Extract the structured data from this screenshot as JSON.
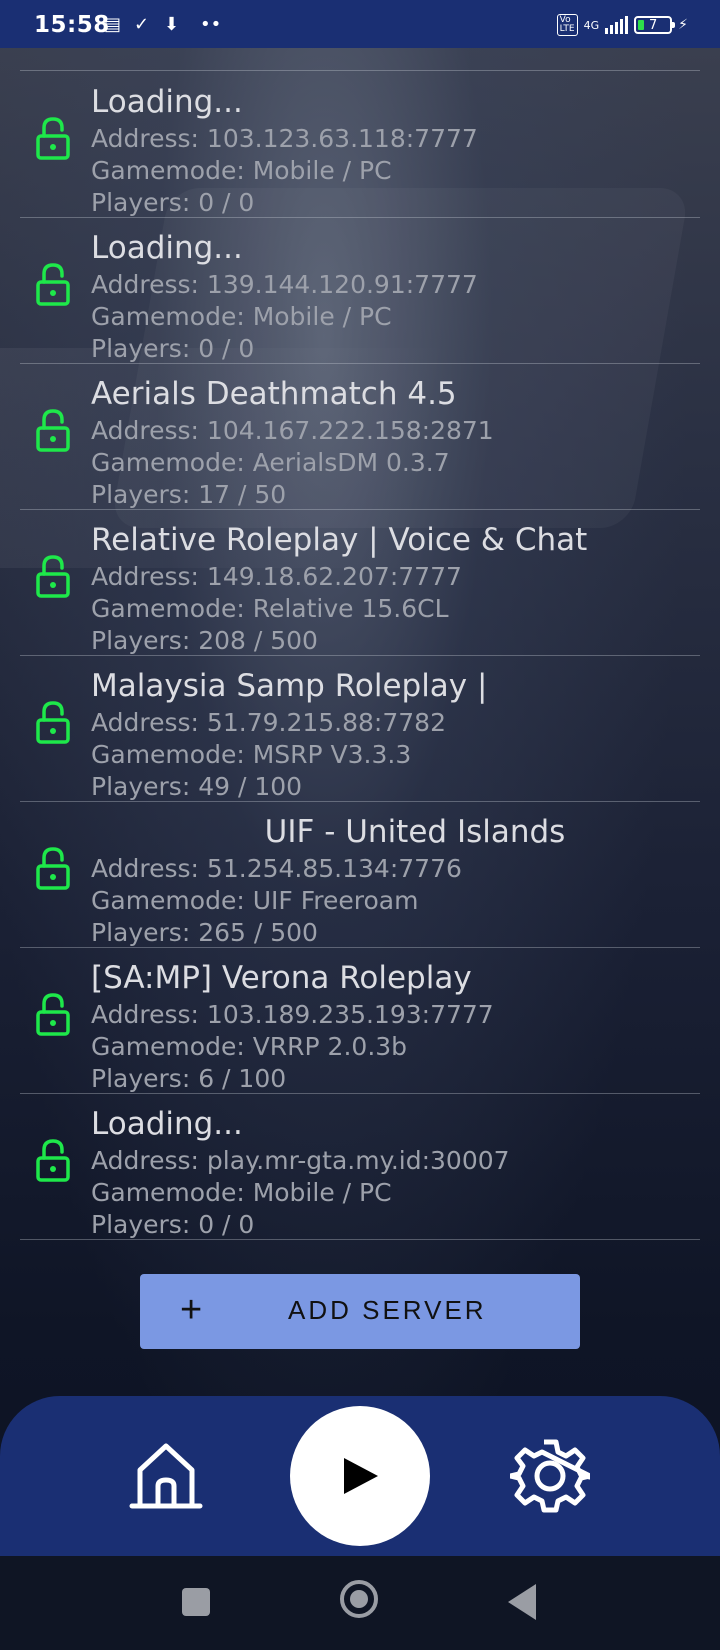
{
  "status_bar": {
    "time": "15:58",
    "network": "4G",
    "battery_level": "7"
  },
  "servers": [
    {
      "name": "Loading...",
      "address": "Address: 103.123.63.118:7777",
      "gamemode": "Gamemode: Mobile / PC",
      "players": "Players: 0 / 0"
    },
    {
      "name": "Loading...",
      "address": "Address: 139.144.120.91:7777",
      "gamemode": "Gamemode: Mobile / PC",
      "players": "Players: 0 / 0"
    },
    {
      "name": "Aerials Deathmatch 4.5",
      "address": "Address: 104.167.222.158:2871",
      "gamemode": "Gamemode: AerialsDM 0.3.7",
      "players": "Players: 17 / 50"
    },
    {
      "name": "Relative Roleplay | Voice & Chat",
      "address": "Address: 149.18.62.207:7777",
      "gamemode": "Gamemode: Relative 15.6CL",
      "players": "Players: 208 / 500"
    },
    {
      "name": "Malaysia Samp Roleplay |",
      "address": "Address: 51.79.215.88:7782",
      "gamemode": "Gamemode: MSRP V3.3.3",
      "players": "Players: 49 / 100"
    },
    {
      "name": "UIF - United Islands",
      "address": "Address: 51.254.85.134:7776",
      "gamemode": "Gamemode: UIF Freeroam",
      "players": "Players: 265 / 500"
    },
    {
      "name": "[SA:MP] Verona Roleplay",
      "address": "Address: 103.189.235.193:7777",
      "gamemode": "Gamemode: VRRP 2.0.3b",
      "players": "Players: 6 / 100"
    },
    {
      "name": "Loading...",
      "address": "Address: play.mr-gta.my.id:30007",
      "gamemode": "Gamemode: Mobile / PC",
      "players": "Players: 0 / 0"
    }
  ],
  "add_server": {
    "icon": "plus-icon",
    "label": "ADD SERVER"
  },
  "bottom_nav": {
    "home_icon": "home-icon",
    "play_icon": "play-icon",
    "settings_icon": "gear-icon"
  },
  "colors": {
    "accent": "#1a2f73",
    "button": "#7b98e3",
    "lock": "#1ee84a"
  }
}
